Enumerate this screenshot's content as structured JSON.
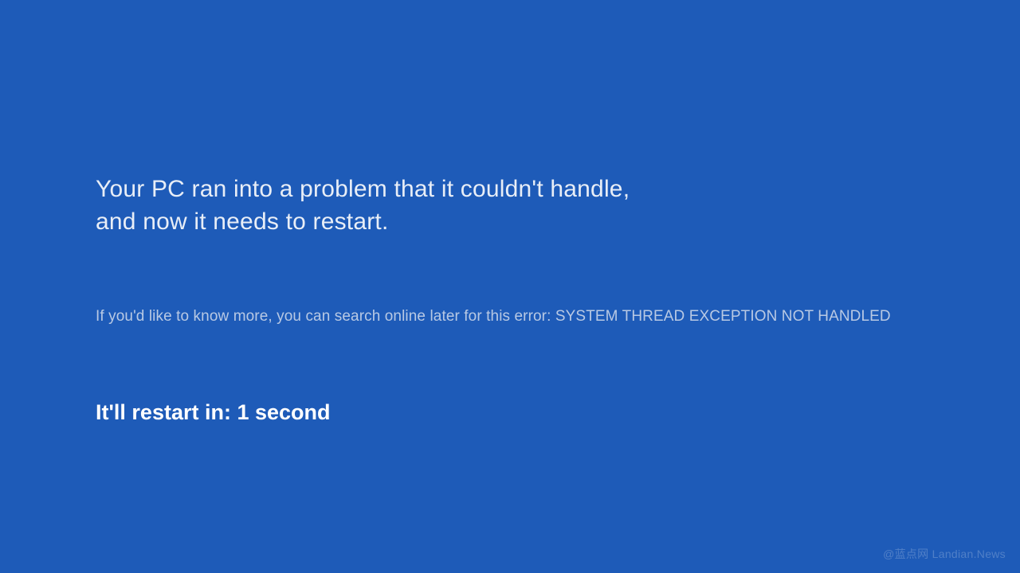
{
  "background_color": "#1e5bb8",
  "message": {
    "headline_line1": "Your PC ran into a problem that it couldn't handle,",
    "headline_line2": "and now it needs to restart.",
    "detail_prefix": "If you'd like to know more, you can search online later for this error: ",
    "error_code": "SYSTEM THREAD EXCEPTION NOT HANDLED",
    "restart_label": "It'll restart in: ",
    "restart_value": "1 second"
  },
  "watermark": "@蓝点网 Landian.News"
}
